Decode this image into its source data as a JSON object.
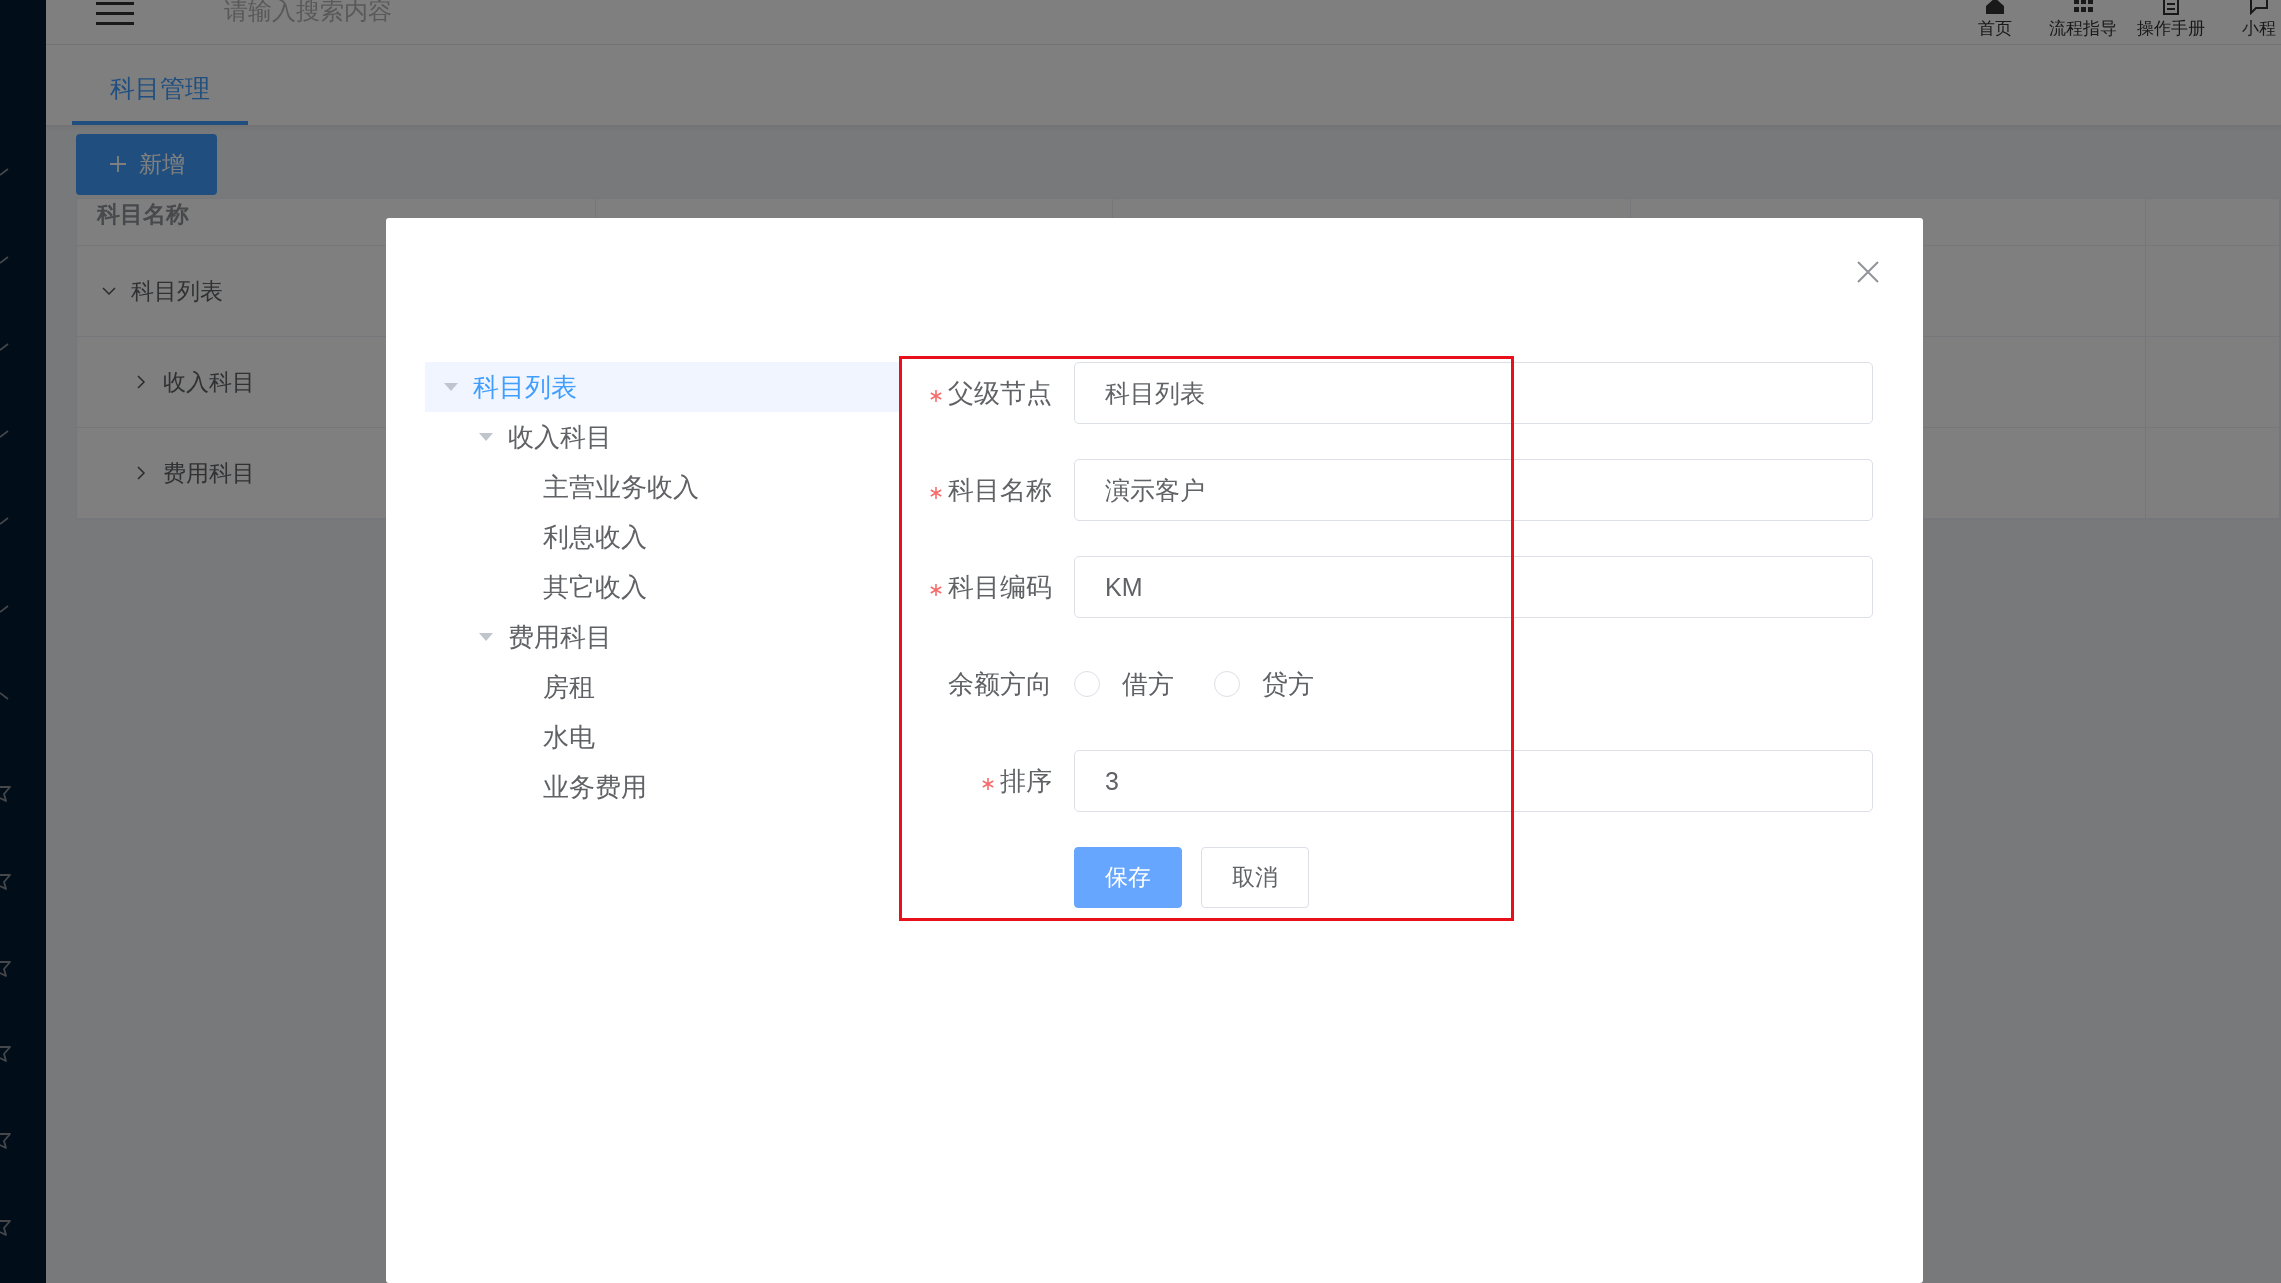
{
  "header": {
    "search_placeholder": "请输入搜索内容",
    "shortcuts": [
      {
        "label": "首页",
        "kind": "home"
      },
      {
        "label": "流程指导",
        "kind": "grid"
      },
      {
        "label": "操作手册",
        "kind": "doc"
      },
      {
        "label": "小程",
        "kind": "chat"
      }
    ]
  },
  "tabs": [
    {
      "label": "科目管理",
      "selected": true
    }
  ],
  "add_button": {
    "label": "新增"
  },
  "table": {
    "columns": [
      "科目名称"
    ],
    "rows": [
      {
        "name": "科目列表",
        "expanded": true,
        "children": [
          {
            "name": "收入科目",
            "expanded": false
          },
          {
            "name": "费用科目",
            "expanded": false
          }
        ]
      }
    ]
  },
  "dialog": {
    "tree": [
      {
        "label": "科目列表",
        "selected": true,
        "expanded": true,
        "children": [
          {
            "label": "收入科目",
            "selected": false,
            "expanded": true,
            "children": [
              {
                "label": "主营业务收入",
                "selected": false
              },
              {
                "label": "利息收入",
                "selected": false
              },
              {
                "label": "其它收入",
                "selected": false
              }
            ]
          },
          {
            "label": "费用科目",
            "selected": false,
            "expanded": true,
            "children": [
              {
                "label": "房租",
                "selected": false
              },
              {
                "label": "水电",
                "selected": false
              },
              {
                "label": "业务费用",
                "selected": false
              }
            ]
          }
        ]
      }
    ],
    "form": {
      "fields": [
        {
          "kind": "input",
          "label": "父级节点",
          "required": true,
          "value": "科目列表"
        },
        {
          "kind": "input",
          "label": "科目名称",
          "required": true,
          "value": "演示客户"
        },
        {
          "kind": "input",
          "label": "科目编码",
          "required": true,
          "value": "KM"
        },
        {
          "kind": "radio",
          "label": "余额方向",
          "required": false,
          "options": [
            {
              "label": "借方",
              "selected": false
            },
            {
              "label": "贷方",
              "selected": false
            }
          ]
        },
        {
          "kind": "input",
          "label": "排序",
          "required": true,
          "value": "3"
        }
      ],
      "buttons": [
        {
          "label": "保存",
          "kind": "primary"
        },
        {
          "label": "取消",
          "kind": "default"
        }
      ]
    }
  }
}
